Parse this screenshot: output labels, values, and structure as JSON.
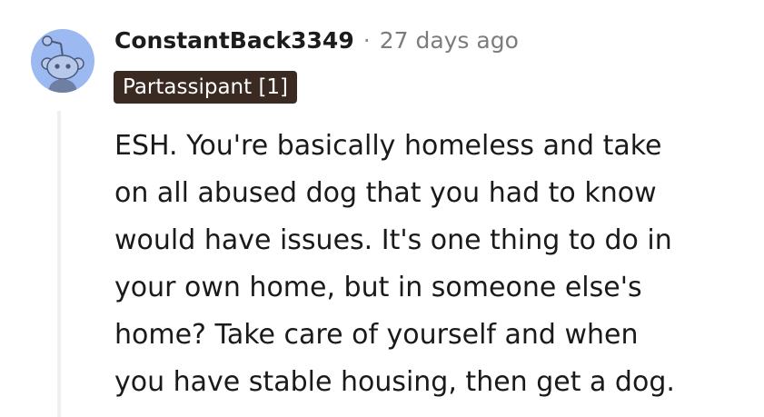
{
  "comment": {
    "author": "ConstantBack3349",
    "separator": "·",
    "timestamp": "27 days ago",
    "flair": "Partassipant [1]",
    "body_lines": [
      "ESH. You're basically homeless and take",
      "on all abused dog that you had to know",
      "would have issues. It's one thing to do in",
      "your own home, but in someone else's",
      "home? Take care of yourself and when",
      "you have stable housing, then get a dog."
    ]
  },
  "colors": {
    "avatar_bg": "#9cb9f2",
    "flair_bg": "#3a2a22",
    "flair_text": "#ffffff",
    "thread_line": "#edeff1",
    "meta_text": "#7c7c7c"
  },
  "icons": {
    "avatar": "reddit-snoo-avatar-icon"
  }
}
